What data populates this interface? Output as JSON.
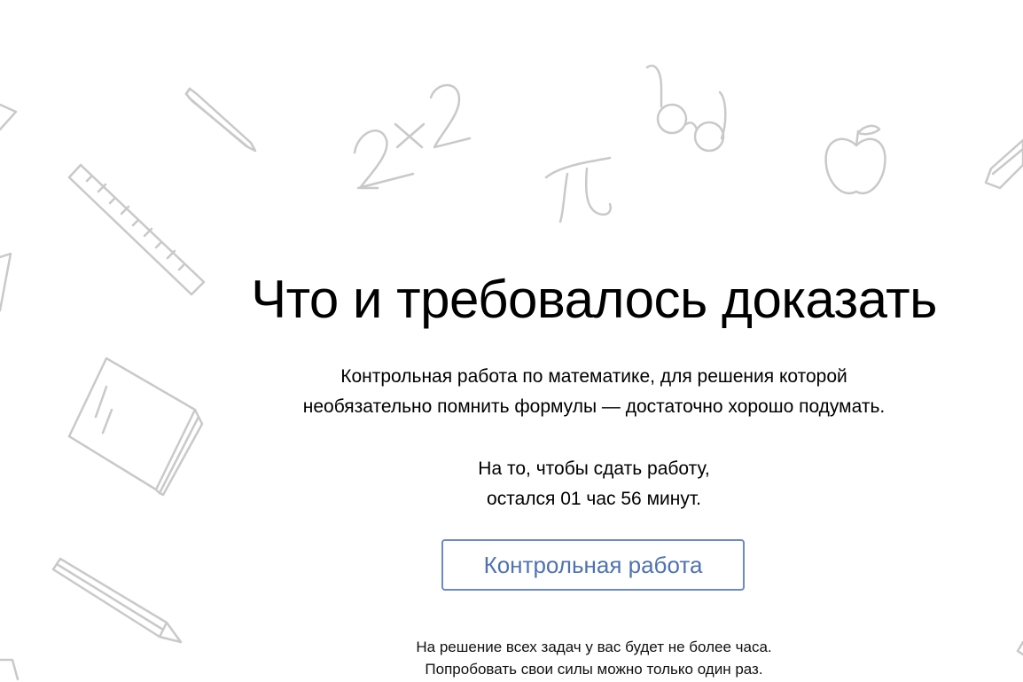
{
  "page": {
    "title": "Что и требовалось доказать",
    "description_lines": [
      "Контрольная работа по математике, для решения которой",
      "необязательно помнить формулы — достаточно хорошо подумать."
    ],
    "time_lines": [
      "На то, чтобы сдать работу,",
      "остался 01 час 56 минут."
    ],
    "start_button_label": "Контрольная работа",
    "note_lines": [
      "На решение всех задач у вас будет не более часа.",
      "Попробовать свои силы можно только один раз."
    ]
  },
  "decorations": {
    "icons": [
      "pencil-icon",
      "ruler-icon",
      "formula-2x2-icon",
      "pi-icon",
      "glasses-icon",
      "apple-icon",
      "notebook-icon"
    ],
    "stroke_color": "#c9c9c9"
  },
  "colors": {
    "button_text": "#4f72b2",
    "button_border": "#6c8ac4",
    "background": "#ffffff"
  }
}
